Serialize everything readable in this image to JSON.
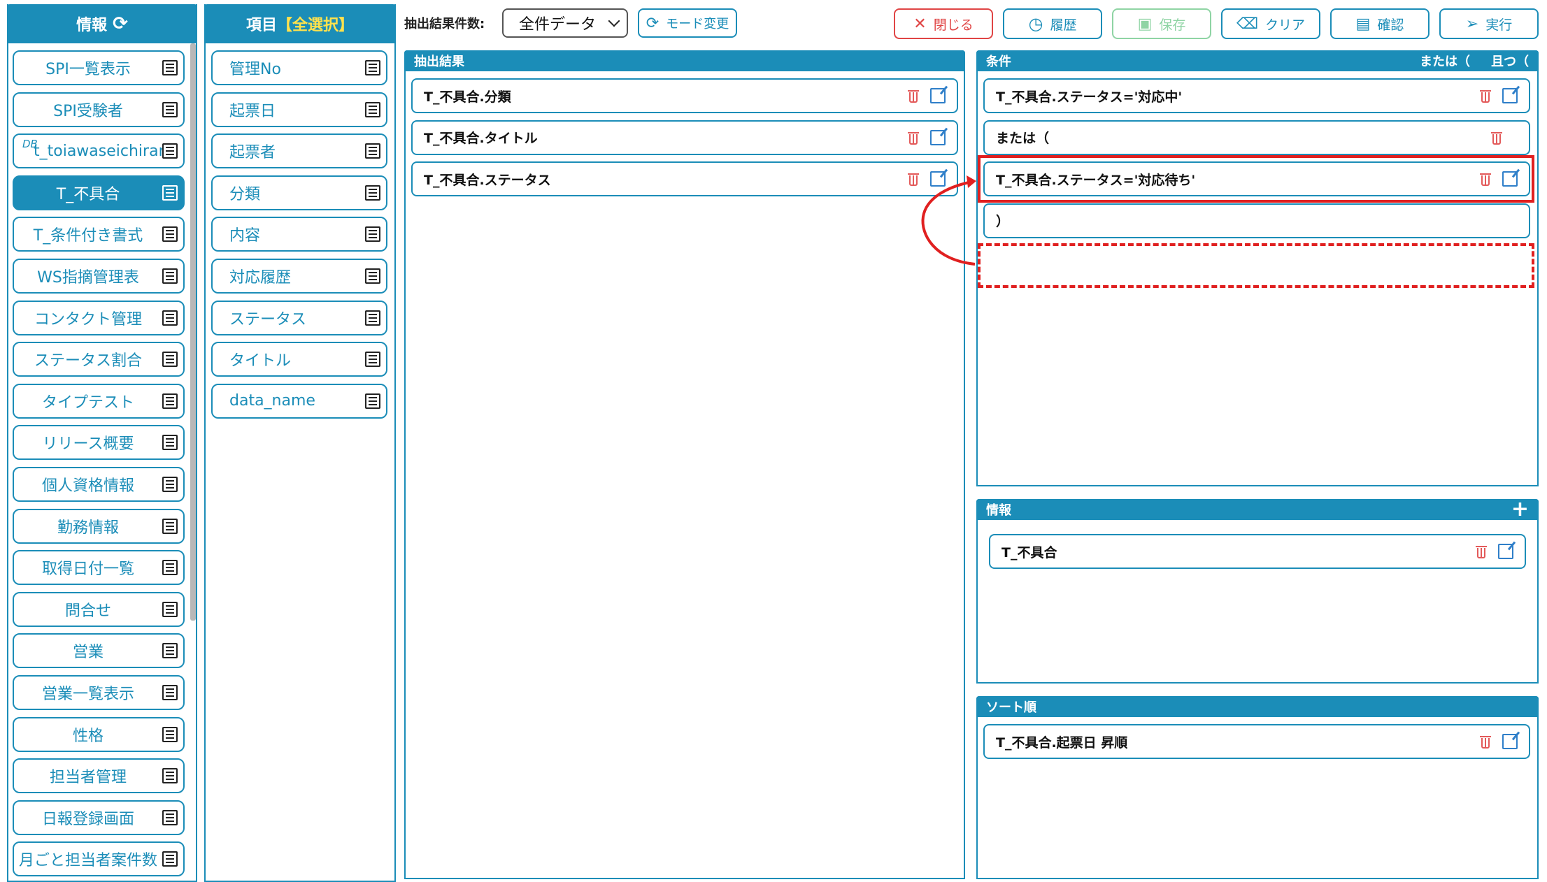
{
  "left_panel": {
    "title": "情報",
    "items": [
      {
        "label": "SPI一覧表示"
      },
      {
        "label": "SPI受験者"
      },
      {
        "label": "t_toiawaseichiran",
        "tag": "DB"
      },
      {
        "label": "T_不具合",
        "active": true
      },
      {
        "label": "T_条件付き書式"
      },
      {
        "label": "WS指摘管理表"
      },
      {
        "label": "コンタクト管理"
      },
      {
        "label": "ステータス割合"
      },
      {
        "label": "タイプテスト"
      },
      {
        "label": "リリース概要"
      },
      {
        "label": "個人資格情報"
      },
      {
        "label": "勤務情報"
      },
      {
        "label": "取得日付一覧"
      },
      {
        "label": "問合せ"
      },
      {
        "label": "営業"
      },
      {
        "label": "営業一覧表示"
      },
      {
        "label": "性格"
      },
      {
        "label": "担当者管理"
      },
      {
        "label": "日報登録画面"
      },
      {
        "label": "月ごと担当者案件数"
      }
    ]
  },
  "fields_panel": {
    "title": "項目",
    "select_all": "【全選択】",
    "items": [
      {
        "label": "管理No"
      },
      {
        "label": "起票日"
      },
      {
        "label": "起票者"
      },
      {
        "label": "分類"
      },
      {
        "label": "内容"
      },
      {
        "label": "対応履歴"
      },
      {
        "label": "ステータス"
      },
      {
        "label": "タイトル"
      },
      {
        "label": "data_name"
      }
    ]
  },
  "toolbar": {
    "count_label": "抽出結果件数:",
    "count_value": "全件データ",
    "mode_label": "モード変更",
    "close_label": "閉じる",
    "history_label": "履歴",
    "save_label": "保存",
    "clear_label": "クリア",
    "confirm_label": "確認",
    "run_label": "実行"
  },
  "results": {
    "title": "抽出結果",
    "rows": [
      "T_不具合.分類",
      "T_不具合.タイトル",
      "T_不具合.ステータス"
    ]
  },
  "conditions": {
    "title": "条件",
    "or_label": "または（",
    "and_label": "且つ（",
    "rows": [
      "T_不具合.ステータス='対応中'",
      "または（",
      "T_不具合.ステータス='対応待ち'",
      "）"
    ]
  },
  "info": {
    "title": "情報",
    "rows": [
      "T_不具合"
    ]
  },
  "sort": {
    "title": "ソート順",
    "rows": [
      "T_不具合.起票日 昇順"
    ]
  },
  "colors": {
    "accent": "#1b8db8",
    "danger": "#e04545",
    "highlight": "#e02020",
    "select_all": "#ffe24d"
  }
}
